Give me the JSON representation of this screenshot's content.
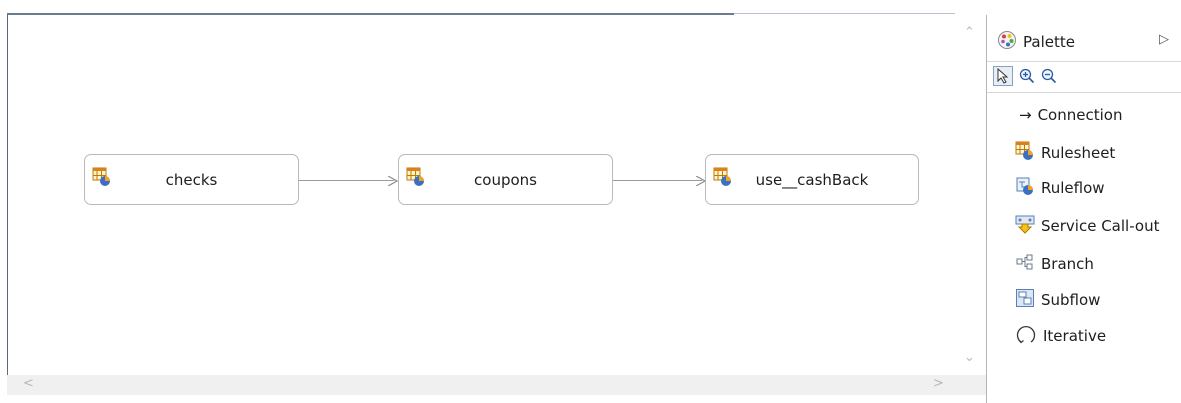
{
  "diagram": {
    "nodes": [
      {
        "label": "checks"
      },
      {
        "label": "coupons"
      },
      {
        "label": "use__cashBack"
      }
    ]
  },
  "palette": {
    "title": "Palette",
    "items": [
      {
        "label": "Connection",
        "icon": "arrow-right-icon"
      },
      {
        "label": "Rulesheet",
        "icon": "rulesheet-icon"
      },
      {
        "label": "Ruleflow",
        "icon": "ruleflow-icon"
      },
      {
        "label": "Service Call-out",
        "icon": "service-call-out-icon"
      },
      {
        "label": "Branch",
        "icon": "branch-icon"
      },
      {
        "label": "Subflow",
        "icon": "subflow-icon"
      },
      {
        "label": "Iterative",
        "icon": "iterative-icon"
      }
    ]
  }
}
